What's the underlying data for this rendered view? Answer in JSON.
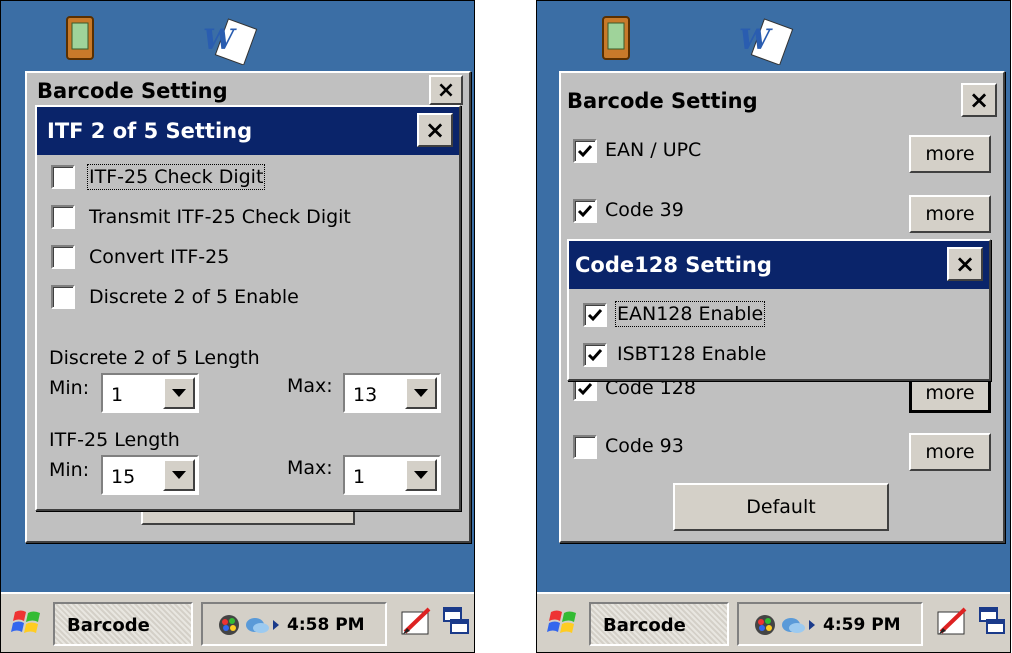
{
  "left_screen": {
    "bg_dialog": {
      "title": "Barcode Setting",
      "close": "×"
    },
    "dialog": {
      "title": "ITF 2 of 5 Setting",
      "close": "×",
      "options": [
        {
          "label": "ITF-25 Check Digit",
          "checked": false,
          "focused": true
        },
        {
          "label": "Transmit ITF-25 Check Digit",
          "checked": false
        },
        {
          "label": "Convert ITF-25",
          "checked": false
        },
        {
          "label": "Discrete 2 of 5 Enable",
          "checked": false
        }
      ],
      "discrete_section": {
        "label": "Discrete 2 of 5 Length",
        "min_label": "Min:",
        "min_value": "1",
        "max_label": "Max:",
        "max_value": "13"
      },
      "itf_section": {
        "label": "ITF-25 Length",
        "min_label": "Min:",
        "min_value": "15",
        "max_label": "Max:",
        "max_value": "1"
      }
    },
    "taskbar": {
      "app": "Barcode",
      "time": "4:58 PM"
    }
  },
  "right_screen": {
    "main_dialog": {
      "title": "Barcode Setting",
      "close": "×",
      "rows": [
        {
          "label": "EAN / UPC",
          "checked": true,
          "more": "more"
        },
        {
          "label": "Code 39",
          "checked": true,
          "more": "more"
        },
        {
          "label": "Code 128",
          "checked": true,
          "more": "more"
        },
        {
          "label": "Code 93",
          "checked": false,
          "more": "more"
        }
      ],
      "default_button": "Default"
    },
    "popup": {
      "title": "Code128 Setting",
      "close": "×",
      "options": [
        {
          "label": "EAN128 Enable",
          "checked": true,
          "focused": true
        },
        {
          "label": "ISBT128 Enable",
          "checked": true
        }
      ]
    },
    "taskbar": {
      "app": "Barcode",
      "time": "4:59 PM"
    }
  },
  "colors": {
    "desktop": "#3b6ea5",
    "title_active": "#0a246a",
    "face": "#c0c0c0"
  },
  "icons": [
    "pda-icon",
    "word-doc-icon",
    "windows-flag-icon",
    "network-icon",
    "sync-icon",
    "input-panel-icon",
    "switch-windows-icon"
  ]
}
